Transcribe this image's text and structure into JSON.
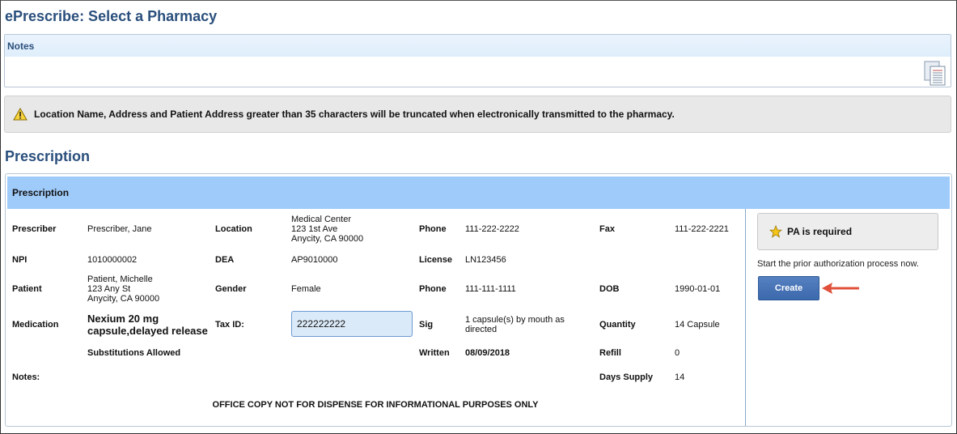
{
  "page": {
    "title": "ePrescribe: Select a Pharmacy"
  },
  "notes": {
    "header": "Notes",
    "icon": "notes-document-icon"
  },
  "warning": {
    "icon": "warning-triangle-icon",
    "text": "Location Name, Address and Patient Address greater than 35 characters will be truncated when electronically transmitted to the pharmacy."
  },
  "section": {
    "title": "Prescription"
  },
  "prescription": {
    "header": "Prescription",
    "prescriber": {
      "label": "Prescriber",
      "value": "Prescriber, Jane"
    },
    "location": {
      "label": "Location",
      "line1": "Medical Center",
      "line2": "123 1st Ave",
      "line3": "Anycity, CA 90000"
    },
    "phone1": {
      "label": "Phone",
      "value": "111-222-2222"
    },
    "fax": {
      "label": "Fax",
      "value": "111-222-2221"
    },
    "npi": {
      "label": "NPI",
      "value": "1010000002"
    },
    "dea": {
      "label": "DEA",
      "value": "AP9010000"
    },
    "license": {
      "label": "License",
      "value": "LN123456"
    },
    "patient": {
      "label": "Patient",
      "line1": "Patient, Michelle",
      "line2": "123 Any St",
      "line3": "Anycity, CA 90000"
    },
    "gender": {
      "label": "Gender",
      "value": "Female"
    },
    "phone2": {
      "label": "Phone",
      "value": "111-111-1111"
    },
    "dob": {
      "label": "DOB",
      "value": "1990-01-01"
    },
    "medication": {
      "label": "Medication",
      "line1": "Nexium 20 mg",
      "line2": "capsule,delayed release"
    },
    "tax_id": {
      "label": "Tax ID:",
      "value": "222222222"
    },
    "sig": {
      "label": "Sig",
      "line1": "1 capsule(s) by mouth as",
      "line2": "directed"
    },
    "quantity": {
      "label": "Quantity",
      "value": "14 Capsule"
    },
    "substitutions": "Substitutions Allowed",
    "written": {
      "label": "Written",
      "value": "08/09/2018"
    },
    "refill": {
      "label": "Refill",
      "value": "0"
    },
    "notes_label": "Notes:",
    "days_supply": {
      "label": "Days Supply",
      "value": "14"
    },
    "footer": "OFFICE COPY NOT FOR DISPENSE FOR INFORMATIONAL PURPOSES ONLY"
  },
  "prior_auth": {
    "icon": "star-icon",
    "title": "PA is required",
    "subtitle": "Start the prior authorization process now.",
    "button": "Create",
    "arrow_icon": "red-arrow-icon"
  }
}
